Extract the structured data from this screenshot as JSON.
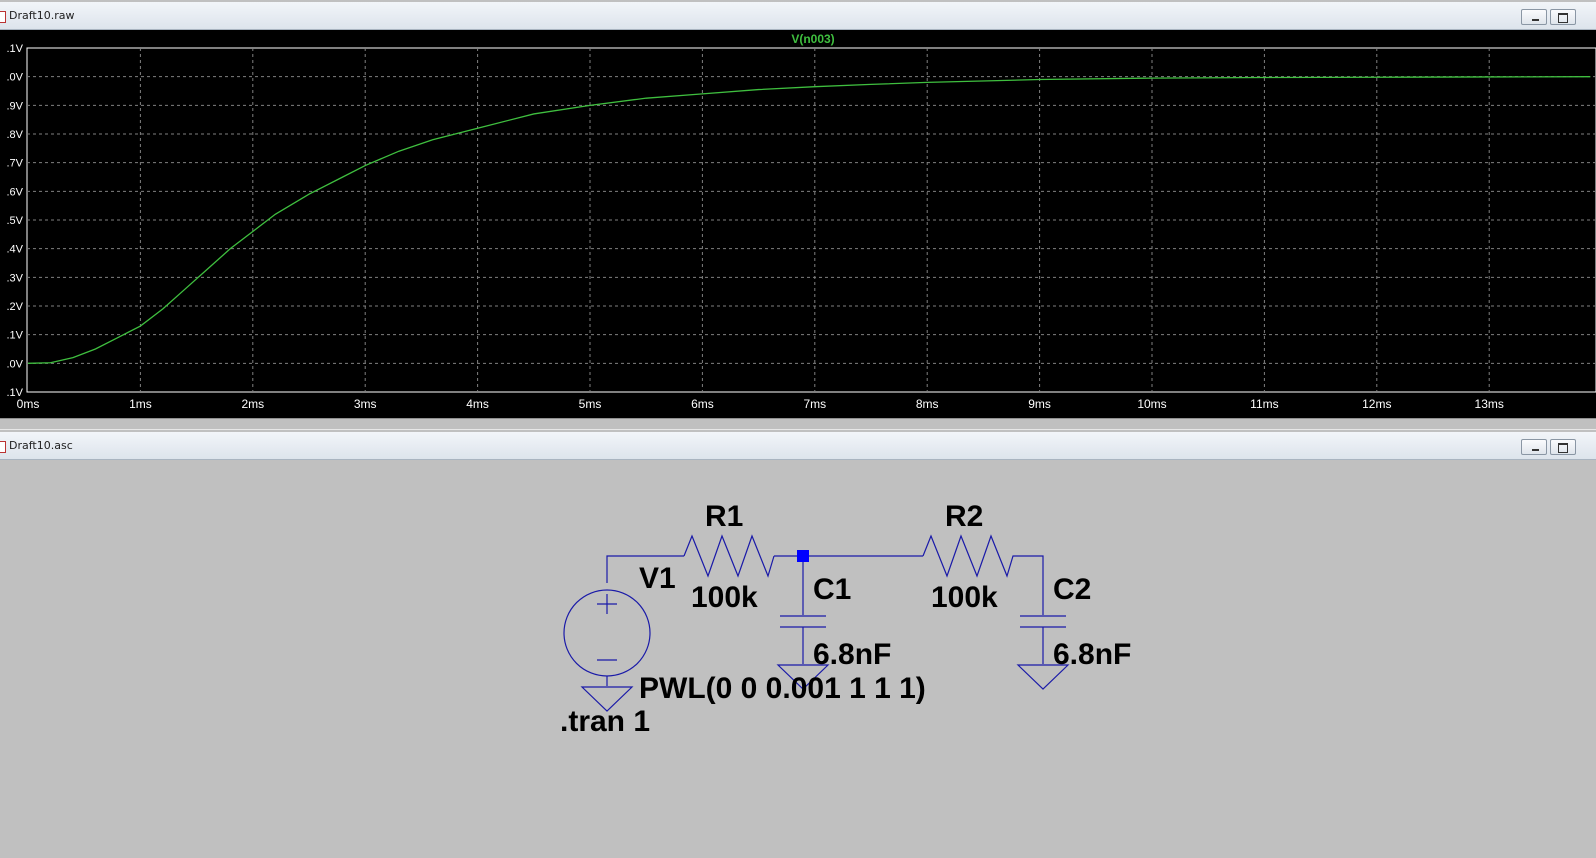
{
  "plot_window": {
    "title": "Draft10.raw"
  },
  "schematic_window": {
    "title": "Draft10.asc"
  },
  "chart_data": {
    "type": "line",
    "title": "V(n003)",
    "xlabel": "",
    "ylabel": "",
    "x_ticks": [
      "0ms",
      "1ms",
      "2ms",
      "3ms",
      "4ms",
      "5ms",
      "6ms",
      "7ms",
      "8ms",
      "9ms",
      "10ms",
      "11ms",
      "12ms",
      "13ms"
    ],
    "y_ticks": [
      ".1V",
      ".0V",
      ".9V",
      ".8V",
      ".7V",
      ".6V",
      ".5V",
      ".4V",
      ".3V",
      ".2V",
      ".1V",
      ".0V",
      ".1V"
    ],
    "xlim": [
      0,
      13.9
    ],
    "ylim": [
      -0.1,
      1.1
    ],
    "grid": true,
    "series": [
      {
        "name": "V(n003)",
        "color": "#3fbf3f",
        "x": [
          0,
          0.2,
          0.4,
          0.6,
          0.8,
          1.0,
          1.2,
          1.4,
          1.6,
          1.8,
          2.0,
          2.2,
          2.5,
          2.8,
          3.0,
          3.3,
          3.6,
          4.0,
          4.5,
          5.0,
          5.5,
          6.0,
          6.5,
          7.0,
          7.5,
          8.0,
          9.0,
          10.0,
          11.0,
          12.0,
          13.0,
          13.9
        ],
        "y": [
          0,
          0.002,
          0.02,
          0.05,
          0.09,
          0.13,
          0.19,
          0.26,
          0.33,
          0.4,
          0.46,
          0.52,
          0.59,
          0.65,
          0.69,
          0.74,
          0.78,
          0.82,
          0.87,
          0.9,
          0.925,
          0.94,
          0.955,
          0.965,
          0.973,
          0.98,
          0.99,
          0.995,
          0.997,
          0.998,
          0.999,
          1.0
        ]
      }
    ]
  },
  "schematic": {
    "r1_name": "R1",
    "r1_value": "100k",
    "r2_name": "R2",
    "r2_value": "100k",
    "c1_name": "C1",
    "c1_value": "6.8nF",
    "c2_name": "C2",
    "c2_value": "6.8nF",
    "v1_name": "V1",
    "v1_value": "PWL(0 0 0.001 1 1 1)",
    "directive": ".tran 1",
    "wire_color": "#1a1aa8",
    "node_color": "#0000ff"
  }
}
